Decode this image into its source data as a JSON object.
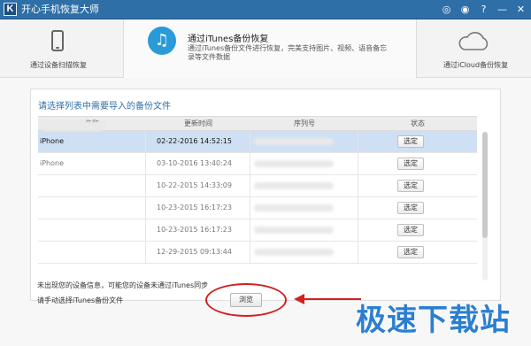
{
  "window": {
    "logo_letter": "K",
    "title": "开心手机恢复大师",
    "controls": [
      {
        "name": "wechat-icon",
        "glyph": "◎"
      },
      {
        "name": "weibo-icon",
        "glyph": "◉"
      },
      {
        "name": "help-icon",
        "glyph": "?"
      },
      {
        "name": "minimize-icon",
        "glyph": "—"
      },
      {
        "name": "close-icon",
        "glyph": "✕"
      }
    ]
  },
  "modes": {
    "device": {
      "label": "通过设备扫描恢复",
      "icon": "phone-icon"
    },
    "itunes": {
      "title": "通过iTunes备份恢复",
      "description": "通过iTunes备份文件进行恢复，完美支持图片、视频、语音备忘录等文件数据",
      "icon": "music-icon",
      "icon_glyph": "♫",
      "active": true
    },
    "icloud": {
      "label": "通过iCloud备份恢复",
      "icon": "cloud-icon"
    }
  },
  "backup_list": {
    "title": "请选择列表中需要导入的备份文件",
    "columns": [
      "名称",
      "更新时间",
      "序列号",
      "状态"
    ],
    "rows": [
      {
        "name": "iPhone",
        "time": "02-22-2016 14:52:15",
        "serial": "",
        "action": "选定",
        "selected": true
      },
      {
        "name": "iPhone",
        "time": "03-10-2016 13:40:24",
        "serial": "",
        "action": "选定",
        "selected": false
      },
      {
        "name": "",
        "time": "10-22-2015 14:33:09",
        "serial": "",
        "action": "选定",
        "selected": false
      },
      {
        "name": "",
        "time": "10-23-2015 16:17:23",
        "serial": "",
        "action": "选定",
        "selected": false
      },
      {
        "name": "",
        "time": "10-23-2015 16:17:23",
        "serial": "",
        "action": "选定",
        "selected": false
      },
      {
        "name": "",
        "time": "12-29-2015 09:13:44",
        "serial": "",
        "action": "选定",
        "selected": false
      }
    ]
  },
  "footer": {
    "hint_not_found": "未出现您的设备信息，可能您的设备未通过iTunes同步",
    "hint_manual": "请手动选择iTunes备份文件",
    "browse_label": "浏览"
  },
  "colors": {
    "titlebar": "#2f6fa7",
    "selected_row": "#cfe0f4",
    "annotation": "#d42020",
    "watermark": "#2c7fd0"
  },
  "watermark": "极速下载站"
}
